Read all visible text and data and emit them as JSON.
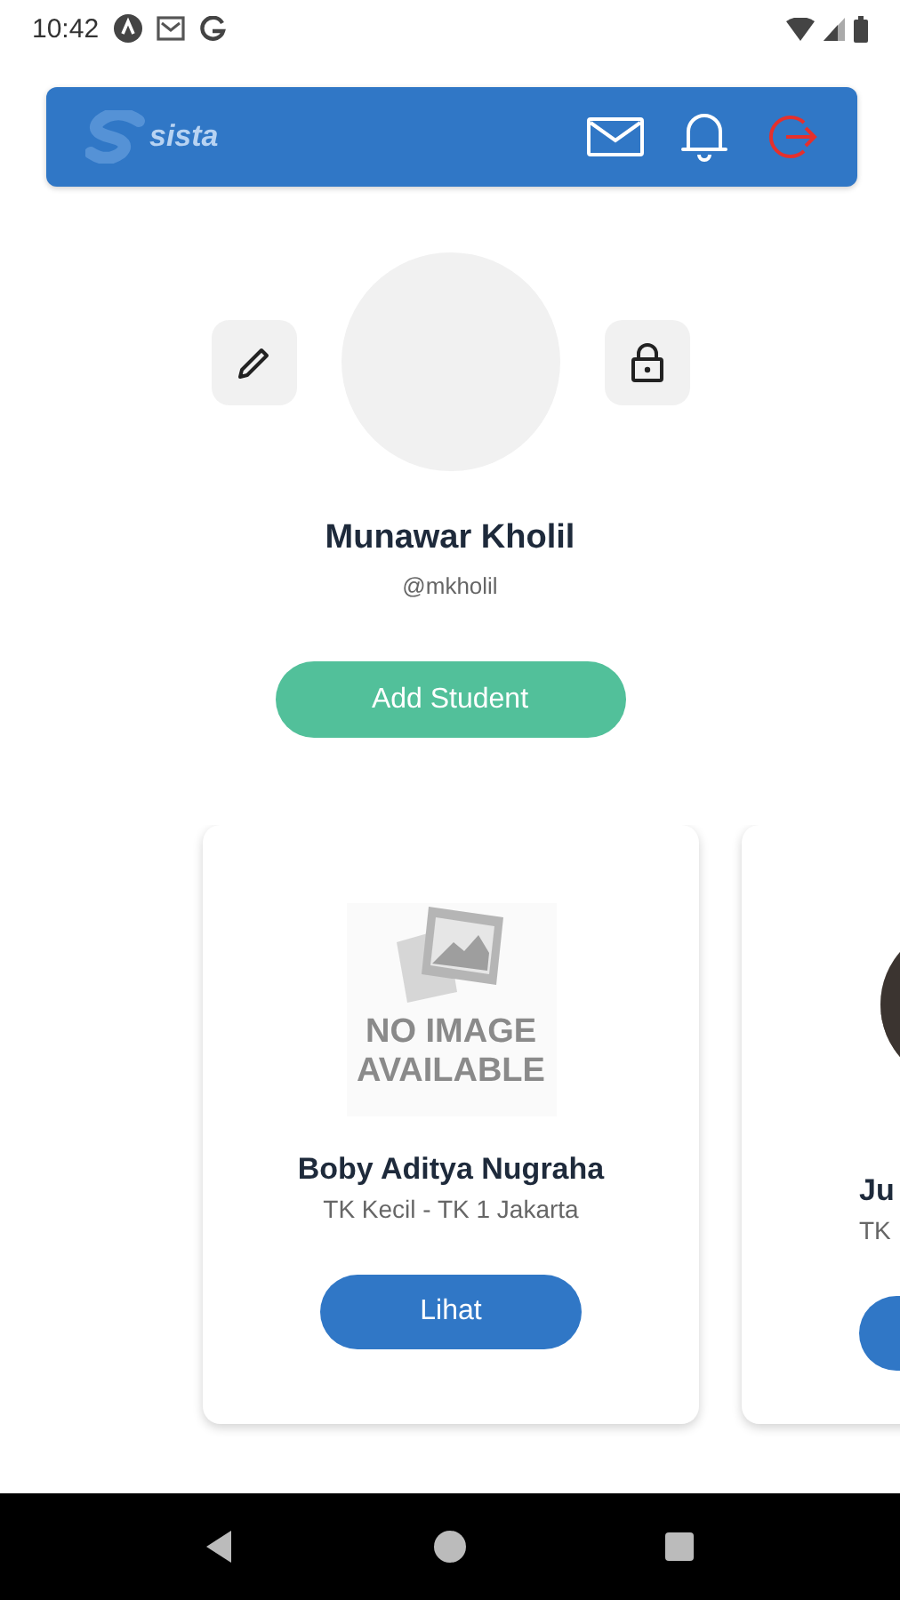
{
  "status_bar": {
    "time": "10:42"
  },
  "header": {
    "logo_text": "sista"
  },
  "profile": {
    "name": "Munawar Kholil",
    "username": "@mkholil"
  },
  "add_button": {
    "label": "Add Student"
  },
  "students": [
    {
      "kind": "no-image",
      "placeholder_text": "NO IMAGE AVAILABLE",
      "name": "Boby Aditya Nugraha",
      "class": "TK Kecil - TK 1 Jakarta",
      "button": "Lihat"
    },
    {
      "name": "Ju",
      "class": "TK"
    }
  ]
}
